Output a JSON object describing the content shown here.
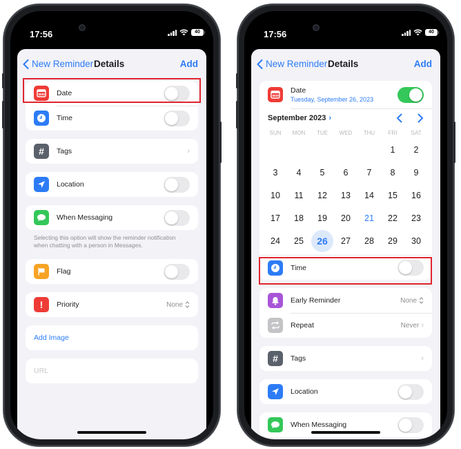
{
  "status_bar": {
    "time": "17:56",
    "battery": "40"
  },
  "colors": {
    "accent": "#2d7cf6",
    "toggle_on": "#34c759",
    "highlight": "#e0242f",
    "icon_date": "#ef3b36",
    "icon_time": "#2d7cf6",
    "icon_tags": "#5b616b",
    "icon_location": "#2d7cf6",
    "icon_messaging": "#34c759",
    "icon_flag": "#f7a325",
    "icon_priority": "#ef3b36",
    "icon_early": "#a855d8",
    "icon_repeat": "#c4c4c7"
  },
  "left": {
    "nav": {
      "back_label": "New Reminder",
      "title": "Details",
      "add_label": "Add"
    },
    "date": {
      "label": "Date",
      "toggle_on": false
    },
    "time": {
      "label": "Time",
      "toggle_on": false
    },
    "tags": {
      "label": "Tags"
    },
    "location": {
      "label": "Location",
      "toggle_on": false
    },
    "messaging": {
      "label": "When Messaging",
      "toggle_on": false,
      "footnote": "Selecting this option will show the reminder notification when chatting with a person in Messages."
    },
    "flag": {
      "label": "Flag",
      "toggle_on": false
    },
    "priority": {
      "label": "Priority",
      "value": "None"
    },
    "add_image": {
      "label": "Add Image"
    },
    "url": {
      "placeholder": "URL"
    }
  },
  "right": {
    "nav": {
      "back_label": "New Reminder",
      "title": "Details",
      "add_label": "Add"
    },
    "date": {
      "label": "Date",
      "value": "Tuesday, September 26, 2023",
      "toggle_on": true
    },
    "calendar": {
      "month_label": "September 2023",
      "weekdays": [
        "SUN",
        "MON",
        "TUE",
        "WED",
        "THU",
        "FRI",
        "SAT"
      ],
      "leading_blanks": 5,
      "days": [
        "1",
        "2",
        "3",
        "4",
        "5",
        "6",
        "7",
        "8",
        "9",
        "10",
        "11",
        "12",
        "13",
        "14",
        "15",
        "16",
        "17",
        "18",
        "19",
        "20",
        "21",
        "22",
        "23",
        "24",
        "25",
        "26",
        "27",
        "28",
        "29",
        "30"
      ],
      "today": "21",
      "selected": "26"
    },
    "time": {
      "label": "Time",
      "toggle_on": false
    },
    "early_reminder": {
      "label": "Early Reminder",
      "value": "None"
    },
    "repeat": {
      "label": "Repeat",
      "value": "Never"
    },
    "tags": {
      "label": "Tags"
    },
    "location": {
      "label": "Location",
      "toggle_on": false
    },
    "messaging": {
      "label": "When Messaging",
      "toggle_on": false
    }
  }
}
